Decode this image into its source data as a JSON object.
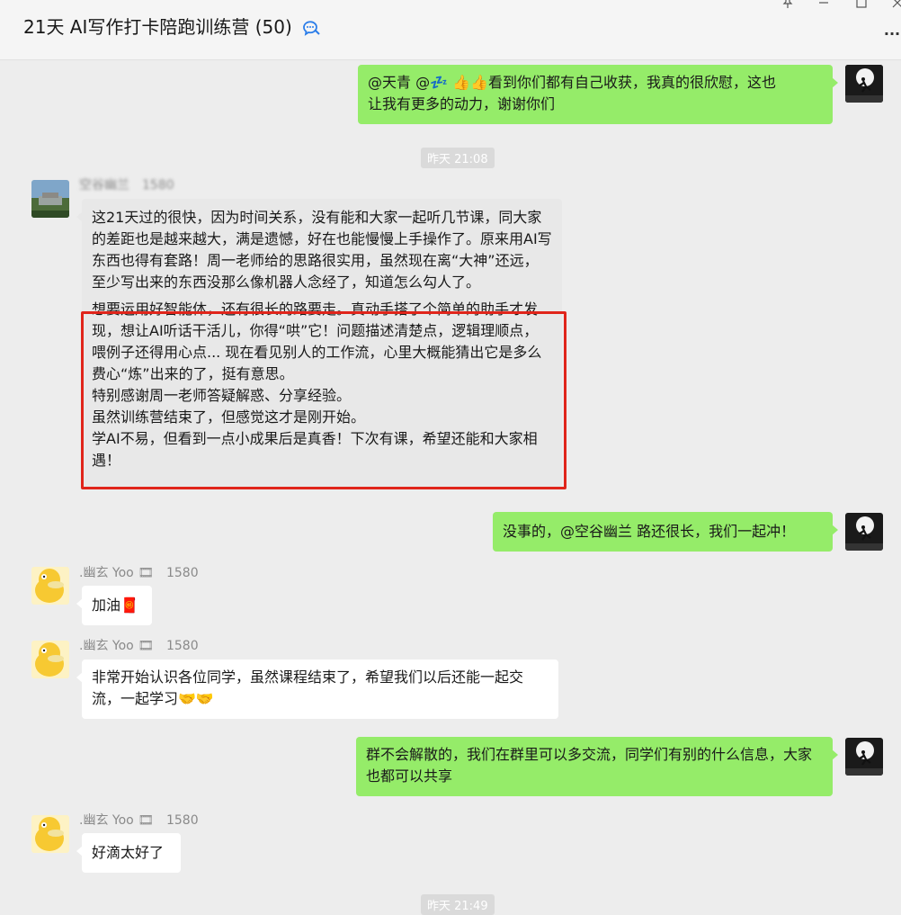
{
  "header": {
    "title": "21天 AI写作打卡陪跑训练营 (50)",
    "controls": [
      "pin-icon",
      "minimize-icon",
      "maximize-icon",
      "more-icon"
    ]
  },
  "messages": [
    {
      "id": "m1",
      "side": "me",
      "text_line1": "@天青 @💤 👍👍看到你们都有自己收获，我真的很欣慰，这也",
      "text_line2": "让我有更多的动力，谢谢你们"
    },
    {
      "id": "t1",
      "type": "time",
      "text": "昨天 21:08"
    },
    {
      "id": "m2",
      "side": "other",
      "sender": "空谷幽兰",
      "sender_num": "1580",
      "para1": "这21天过的很快，因为时间关系，没有能和大家一起听几节课，同大家的差距也是越来越大，满是遗憾，好在也能慢慢上手操作了。原来用AI写东西也得有套路！周一老师给的思路很实用，虽然现在离“大神”还远，至少写出来的东西没那么像机器人念经了，知道怎么勾人了。",
      "para2": "想要运用好智能体，还有很长的路要走。真动手搭了个简单的助手才发现，想让AI听话干活儿，你得“哄”它！问题描述清楚点，逻辑理顺点，喂例子还得用心点... 现在看见别人的工作流，心里大概能猜出它是多么费心“炼”出来的了，挺有意思。",
      "para3": "特别感谢周一老师答疑解惑、分享经验。",
      "para4": "虽然训练营结束了，但感觉这才是刚开始。",
      "para5": "学AI不易，但看到一点小成果后是真香！下次有课，希望还能和大家相遇！"
    },
    {
      "id": "m3",
      "side": "me",
      "text": "没事的，@空谷幽兰 路还很长，我们一起冲！"
    },
    {
      "id": "m4",
      "side": "other",
      "sender": ".幽玄 Yoo",
      "sender_num": "1580",
      "text": "加油🧧"
    },
    {
      "id": "m5",
      "side": "other",
      "sender": ".幽玄 Yoo",
      "sender_num": "1580",
      "text": "非常开始认识各位同学，虽然课程结束了，希望我们以后还能一起交流，一起学习🤝🤝"
    },
    {
      "id": "m6",
      "side": "me",
      "text": "群不会解散的，我们在群里可以多交流，同学们有别的什么信息，大家也都可以共享"
    },
    {
      "id": "m7",
      "side": "other",
      "sender": ".幽玄 Yoo",
      "sender_num": "1580",
      "text": "好滴太好了"
    },
    {
      "id": "t2",
      "type": "time",
      "text": "昨天 21:49"
    }
  ],
  "colors": {
    "my_bubble": "#95ec69",
    "other_bubble": "#ffffff",
    "highlight": "#e0251b",
    "background": "#ededed"
  }
}
